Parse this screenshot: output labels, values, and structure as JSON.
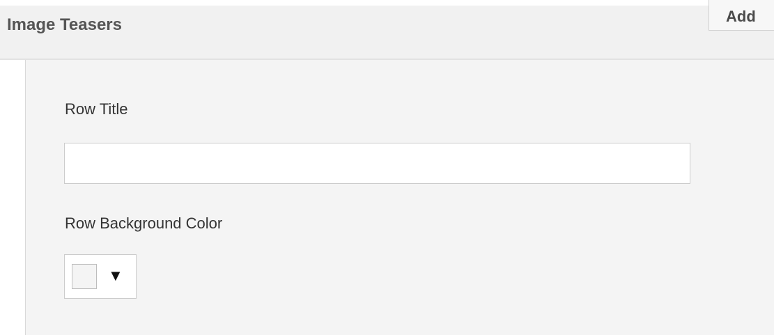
{
  "section": {
    "title": "Image Teasers",
    "add_label": "Add"
  },
  "form": {
    "row_title": {
      "label": "Row Title",
      "value": "",
      "placeholder": ""
    },
    "row_background_color": {
      "label": "Row Background Color",
      "swatch_color": "#f4f4f4",
      "arrow_glyph": "▼"
    }
  },
  "icons": {
    "dropdown": "chevron-down-icon"
  }
}
